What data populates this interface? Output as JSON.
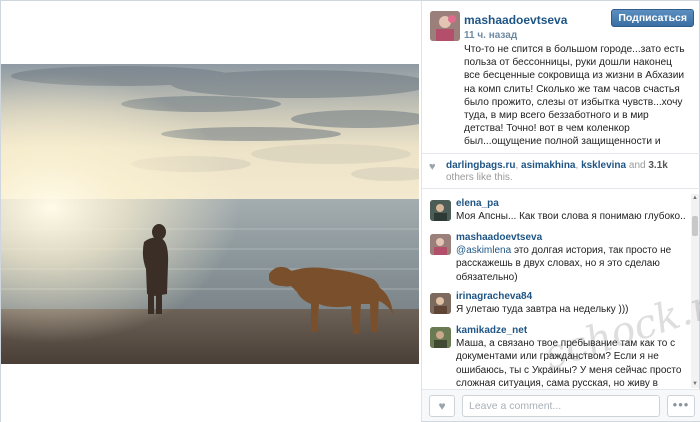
{
  "post": {
    "username": "mashaadoevtseva",
    "follow_label": "Подписаться",
    "time_ago": "11 ч. назад",
    "caption": "Что-то не спится в большом городе...зато есть польза от бессонницы, руки дошли наконец все бесценные сокровища из жизни в Абхазии на комп слить! Сколько же там часов счастья было прожито, слезы от избытка чувств...хочу туда, в мир всего беззаботного и в мир детства! Точно! вот в чем коленкор был...ощущение полной защищенности и стерильности от всякого"
  },
  "likes": {
    "user1": "darlingbags.ru",
    "sep1": ", ",
    "user2": "asimakhina",
    "sep2": ", ",
    "user3": "ksklevina",
    "and": " and ",
    "count": "3.1k",
    "suffix": " others like this."
  },
  "comments": [
    {
      "user": "elena_pa",
      "text": "Моя Апсны... Как твои слова я понимаю глубоко.."
    },
    {
      "user": "mashaadoevtseva",
      "mention": "@askimlena",
      "text": " это долгая история, так просто не расскажешь в двух словах, но я это сделаю обязательно)"
    },
    {
      "user": "irinagracheva84",
      "text": "Я улетаю туда завтра на недельку )))"
    },
    {
      "user": "kamikadze_net",
      "text": "Маша, а связано твое пребывание там как то с документами или гражданством? Если я не ошибаюсь, ты с Украины? У меня сейчас просто сложная ситуация, сама русская, но живу в"
    }
  ],
  "footer": {
    "comment_placeholder": "Leave a comment...",
    "more_label": "•••"
  },
  "icons": {
    "heart": "♥"
  },
  "watermark": "schock.ru",
  "colors": {
    "link": "#1f5585",
    "follow_button": "#3b6fa3"
  }
}
